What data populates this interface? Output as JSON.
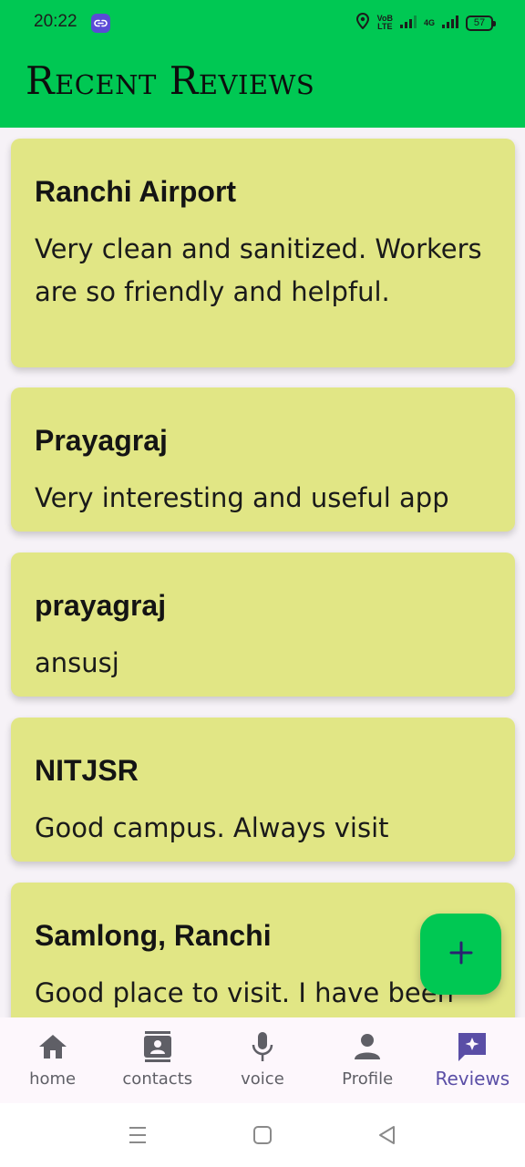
{
  "status_bar": {
    "time": "20:22",
    "network_label_top": "VoB",
    "network_label_bottom": "LTE",
    "signal_label": "4G",
    "battery": "57"
  },
  "app_bar": {
    "title": "Recent Reviews"
  },
  "reviews": [
    {
      "place": "Ranchi Airport",
      "text": "Very clean and sanitized. Workers are so friendly and helpful."
    },
    {
      "place": "Prayagraj",
      "text": "Very interesting and useful app"
    },
    {
      "place": "prayagraj",
      "text": "ansusj"
    },
    {
      "place": "NITJSR",
      "text": "Good campus. Always visit"
    },
    {
      "place": "Samlong, Ranchi",
      "text": "Good place to visit. I have been"
    }
  ],
  "fab": {
    "icon": "plus-icon"
  },
  "bottom_nav": {
    "items": [
      {
        "label": "home",
        "icon": "home-icon"
      },
      {
        "label": "contacts",
        "icon": "contacts-icon"
      },
      {
        "label": "voice",
        "icon": "microphone-icon"
      },
      {
        "label": "Profile",
        "icon": "person-icon"
      },
      {
        "label": "Reviews",
        "icon": "reviews-icon"
      }
    ],
    "active": "Reviews"
  },
  "colors": {
    "primary": "#00c853",
    "card": "#e1e685",
    "nav_active": "#5a4ea6",
    "nav_inactive": "#5f5f66"
  }
}
